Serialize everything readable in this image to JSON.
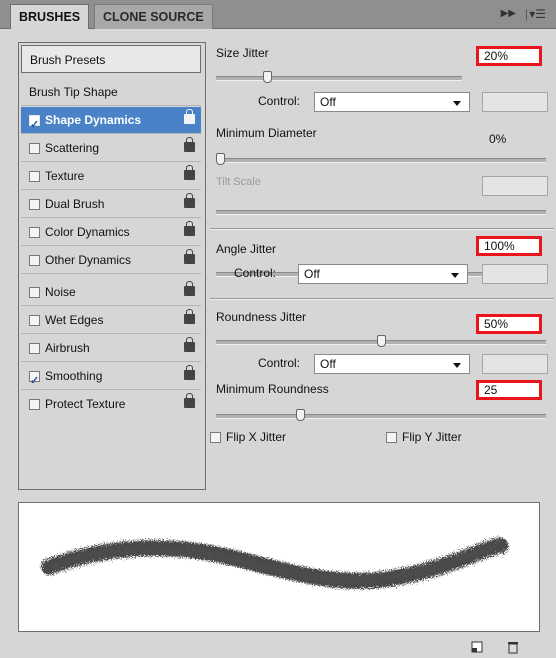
{
  "tabs": [
    {
      "label": "BRUSHES",
      "active": true
    },
    {
      "label": "CLONE SOURCE",
      "active": false
    }
  ],
  "tab_controls": {
    "collapse_icon": "double-chevron-right-icon",
    "menu_icon": "panel-menu-icon"
  },
  "left_list": {
    "preset_button": "Brush Presets",
    "header": "Brush Tip Shape",
    "items": [
      {
        "label": "Shape Dynamics",
        "checked": true,
        "selected": true
      },
      {
        "label": "Scattering",
        "checked": false
      },
      {
        "label": "Texture",
        "checked": false
      },
      {
        "label": "Dual Brush",
        "checked": false
      },
      {
        "label": "Color Dynamics",
        "checked": false
      },
      {
        "label": "Other Dynamics",
        "checked": false
      },
      {
        "label": "Noise",
        "checked": false
      },
      {
        "label": "Wet Edges",
        "checked": false
      },
      {
        "label": "Airbrush",
        "checked": false
      },
      {
        "label": "Smoothing",
        "checked": true
      },
      {
        "label": "Protect Texture",
        "checked": false
      }
    ]
  },
  "settings": {
    "size_jitter": {
      "label": "Size Jitter",
      "value": "20%",
      "level": 0.2
    },
    "control1": {
      "label": "Control:",
      "value": "Off"
    },
    "minimum_diameter": {
      "label": "Minimum Diameter",
      "value": "0%",
      "level": 0.0
    },
    "tilt_scale": {
      "label": "Tilt Scale"
    },
    "angle_jitter": {
      "label": "Angle Jitter",
      "value": "100%",
      "level": 1.0
    },
    "control2": {
      "label": "Control:",
      "value": "Off"
    },
    "roundness_jitter": {
      "label": "Roundness Jitter",
      "value": "50%",
      "level": 0.5
    },
    "control3": {
      "label": "Control:",
      "value": "Off"
    },
    "minimum_roundness": {
      "label": "Minimum Roundness",
      "value": "25",
      "level": 0.25
    },
    "flip_x": {
      "label": "Flip X Jitter",
      "checked": false
    },
    "flip_y": {
      "label": "Flip Y Jitter",
      "checked": false
    }
  },
  "colors": {
    "highlight": "#e8161c",
    "selection": "#4a82c7"
  },
  "bottom_icons": [
    "new-preset-icon",
    "trash-icon"
  ]
}
